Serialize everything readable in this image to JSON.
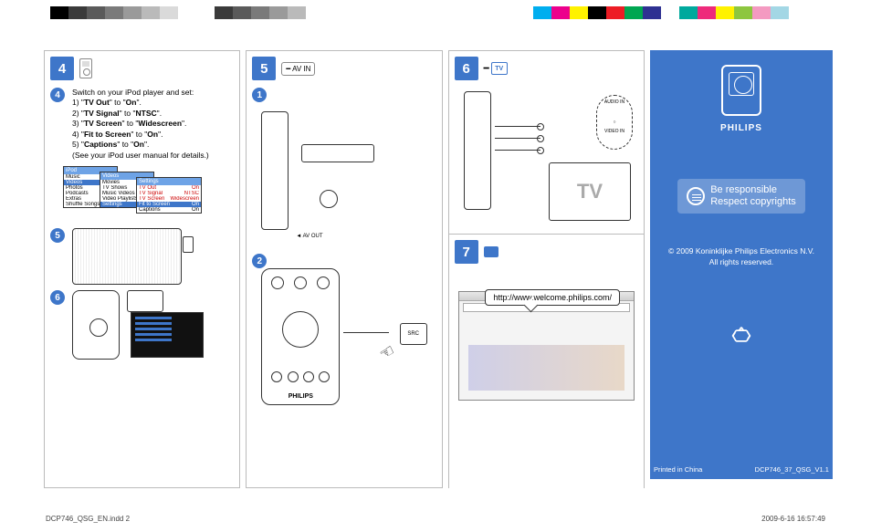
{
  "colorbar_left": [
    "#000000",
    "#3a3a3a",
    "#5a5a5a",
    "#7a7a7a",
    "#9a9a9a",
    "#bababa",
    "#dadada",
    "#ffffff",
    "#ffffff",
    "#3a3a3a",
    "#5a5a5a",
    "#7a7a7a",
    "#9a9a9a",
    "#bababa"
  ],
  "colorbar_right": [
    "#00aeef",
    "#ec008c",
    "#fff200",
    "#000000",
    "#ed1c24",
    "#00a651",
    "#2e3192",
    "#ffffff",
    "#00a99d",
    "#ee2a7b",
    "#fff200",
    "#8dc63f",
    "#f49ac1",
    "#a3d7e5"
  ],
  "col1": {
    "header_num": "4",
    "step4_circ": "4",
    "step4_intro": "Switch on your iPod player and set:",
    "s1a": "1) \"",
    "s1b": "TV Out",
    "s1c": "\" to \"",
    "s1d": "On",
    "s1e": "\".",
    "s2a": "2) \"",
    "s2b": "TV Signal",
    "s2c": "\" to \"",
    "s2d": "NTSC",
    "s2e": "\".",
    "s3a": "3) \"",
    "s3b": "TV Screen",
    "s3c": "\" to \"",
    "s3d": "Widescreen",
    "s3e": "\".",
    "s4a": "4) \"",
    "s4b": "Fit to Screen",
    "s4c": "\" to \"",
    "s4d": "On",
    "s4e": "\".",
    "s5a": "5) \"",
    "s5b": "Captions",
    "s5c": "\" to \"",
    "s5d": "On",
    "s5e": "\".",
    "s6": "(See your iPod user manual for details.)",
    "menu1_title": "iPod",
    "menu1_items": [
      "Music",
      "Videos",
      "Photos",
      "Podcasts",
      "Extras",
      "Shuffle Songs"
    ],
    "menu2_title": "Videos",
    "menu2_items": [
      "Movies",
      "TV Shows",
      "Music Videos",
      "Video Playlists",
      "Settings"
    ],
    "menu3_title": "Settings",
    "menu3_rows": [
      {
        "k": "TV Out",
        "v": "On"
      },
      {
        "k": "TV Signal",
        "v": "NTSC"
      },
      {
        "k": "TV Screen",
        "v": "Widescreen"
      },
      {
        "k": "Fit to Screen",
        "v": "On"
      },
      {
        "k": "Captions",
        "v": "On"
      }
    ],
    "circ5": "5",
    "circ6": "6"
  },
  "col2": {
    "header_num": "5",
    "header_label": "AV IN",
    "circ1": "1",
    "avout": "AV OUT",
    "circ2": "2",
    "src": "SRC",
    "remote_brand": "PHILIPS"
  },
  "col3": {
    "header_num": "6",
    "header_label": "TV",
    "audio_in": "AUDIO IN",
    "video_in": "VIDEO IN",
    "tv_text": "TV",
    "header_num2": "7",
    "url": "http://www.welcome.philips.com/"
  },
  "rightpanel": {
    "brand": "PHILIPS",
    "slogan1": "Be responsible",
    "slogan2": "Respect copyrights",
    "copyright1": "© 2009 Koninklijke Philips Electronics N.V.",
    "copyright2": "All rights reserved.",
    "printed": "Printed in China",
    "doccode": "DCP746_37_QSG_V1.1"
  },
  "footer": {
    "left": "DCP746_QSG_EN.indd   2",
    "right": "2009-6-16   16:57:49"
  }
}
